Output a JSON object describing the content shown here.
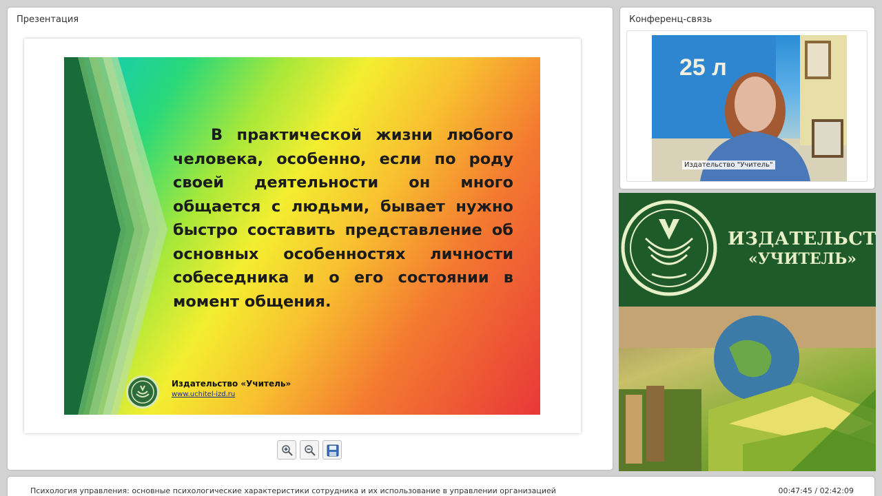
{
  "presentation": {
    "title": "Презентация",
    "slide": {
      "text": "В практической жизни любого человека, особенно, если по роду своей деятельности он много общается с людьми, бывает нужно быстро составить представление об основных особенностях личности собеседника и о его состоянии в момент общения.",
      "publisher": "Издательство «Учитель»",
      "url": "www.uchitel-izd.ru"
    },
    "toolbar": {
      "zoom_in_icon": "zoom-in-icon",
      "zoom_out_icon": "zoom-out-icon",
      "save_icon": "floppy-disk-icon"
    }
  },
  "conference": {
    "title": "Конференц-связь",
    "video_caption": "Издательство \"Учитель\"",
    "poster_number": "25 л"
  },
  "banner": {
    "name_line1": "ИЗДАТЕЛЬСТВО",
    "name_line2": "«УЧИТЕЛЬ»"
  },
  "footer": {
    "course_title": "Психология управления: основные психологические характеристики сотрудника и их использование в управлении организацией",
    "time": "00:47:45 / 02:42:09"
  },
  "colors": {
    "banner_green": "#1f5a2a",
    "logo_cream": "#e8f0c8",
    "url_blue": "#1b2a8a"
  }
}
